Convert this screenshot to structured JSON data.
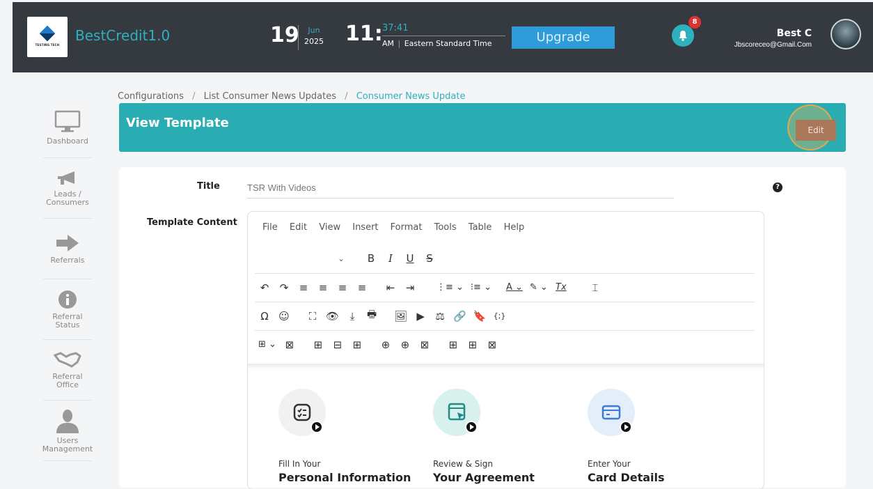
{
  "header": {
    "brand": "BestCredit1.0",
    "logo_text": "TESTING TECH",
    "day": "19",
    "month": "Jun",
    "year": "2025",
    "hour": "11:",
    "minutes": "37:41",
    "ampm": "AM",
    "timezone": "Eastern Standard Time",
    "upgrade_label": "Upgrade",
    "notification_count": "8",
    "user_name": "Best C",
    "user_email": "Jbscoreceo@Gmail.Com"
  },
  "sidebar": {
    "items": [
      {
        "label": "Dashboard",
        "icon": "monitor-icon"
      },
      {
        "label": "Leads / Consumers",
        "icon": "megaphone-icon"
      },
      {
        "label": "Referrals",
        "icon": "arrow-right-icon"
      },
      {
        "label": "Referral Status",
        "icon": "info-icon"
      },
      {
        "label": "Referral Office",
        "icon": "handshake-icon"
      },
      {
        "label": "Users Management",
        "icon": "user-icon"
      }
    ]
  },
  "breadcrumb": {
    "items": [
      "Configurations",
      "List Consumer News Updates"
    ],
    "current": "Consumer News Update"
  },
  "page": {
    "title": "View Template",
    "edit_label": "Edit"
  },
  "form": {
    "title_label": "Title",
    "title_value": "TSR With Videos",
    "content_label": "Template Content",
    "help_glyph": "?"
  },
  "editor": {
    "menu": [
      "File",
      "Edit",
      "View",
      "Insert",
      "Format",
      "Tools",
      "Table",
      "Help"
    ],
    "toolbar_row1": [
      "⌄",
      "B",
      "I",
      "U",
      "S"
    ],
    "toolbar_row2": [
      "↶",
      "↷",
      "≡",
      "≡",
      "≡",
      "≡",
      "⇤",
      "⇥",
      "⋮≡ ⌄",
      "⁝≡ ⌄",
      "A ⌄",
      "✎ ⌄",
      "Tx",
      "⌶"
    ],
    "toolbar_row3": [
      "Ω",
      "☺",
      "⛶",
      "👁",
      "⤓",
      "🖶",
      "🖼",
      "▶",
      "⚖",
      "🔗",
      "🔖",
      "{;}"
    ],
    "toolbar_row4": [
      "⊞ ⌄",
      "⊠",
      "⊞",
      "⊟",
      "⊞",
      "⊕",
      "⊕",
      "⊠",
      "⊞",
      "⊞",
      "⊠"
    ]
  },
  "features": [
    {
      "small": "Fill In Your",
      "big": "Personal Information",
      "icon": "checklist-icon",
      "bg": "#f1f1f1"
    },
    {
      "small": "Review & Sign",
      "big": "Your Agreement",
      "icon": "sign-document-icon",
      "bg": "#d8f1ee"
    },
    {
      "small": "Enter Your",
      "big": "Card Details",
      "icon": "credit-card-icon",
      "bg": "#e4eefb"
    }
  ],
  "colors": {
    "accent": "#29adb3",
    "header_bg": "#343a40",
    "upgrade": "#2e9cd8",
    "badge": "#e03131"
  }
}
